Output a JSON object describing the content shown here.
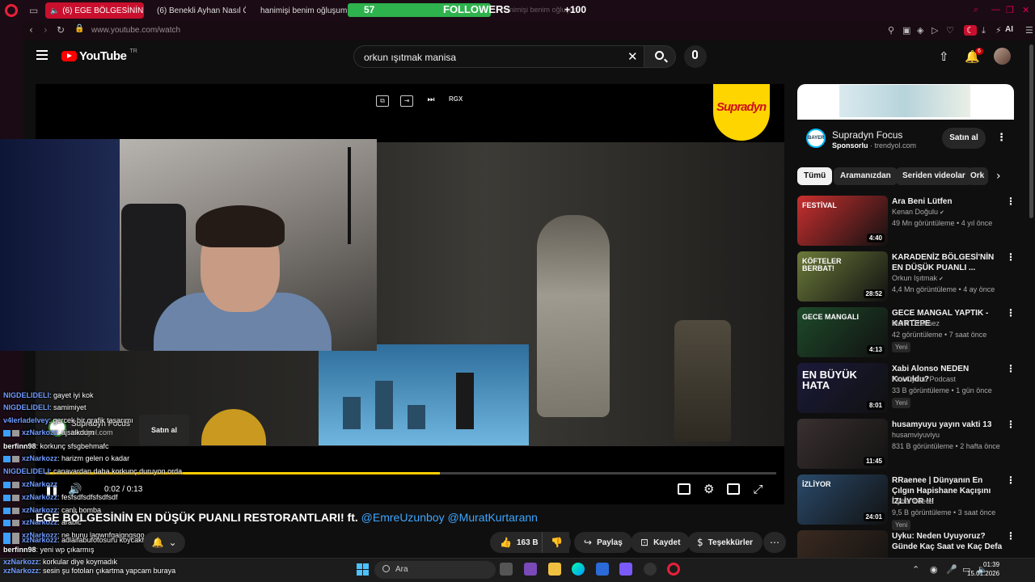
{
  "browser": {
    "tabs": [
      {
        "label": "(6) EGE BÖLGESİNİN E",
        "active": true
      },
      {
        "label": "(6) Benekli Ayhan Nasıl Öl",
        "active": false
      },
      {
        "label": "hanimişi benim oğluşum",
        "active": false
      }
    ],
    "faded_tab_text": "hanimişi benim oğluşum",
    "url": "www.youtube.com/watch",
    "ai_label": "AI"
  },
  "overlay_followers": {
    "current": "57",
    "label": "FOLLOWERS",
    "goal": "+100",
    "fill_fraction": 0.57,
    "color": "#2eb24d"
  },
  "youtube": {
    "logo_text": "YouTube",
    "region": "TR",
    "search_query": "orkun ışıtmak manisa",
    "notification_count": "6"
  },
  "player": {
    "overlay_btn": "RGX",
    "ad_brand": "Supradyn",
    "current_time": "0:02",
    "duration": "0:13",
    "time_display": "0:02 / 0:13",
    "progress_fraction": 0.54,
    "progress_color": "#ffcc00",
    "ad_overlay": {
      "name": "Supradyn Focus",
      "domain": "trendyol.com",
      "button": "Satın al"
    }
  },
  "video": {
    "title": "EGE BÖLGESİNİN EN DÜŞÜK PUANLI RESTORANTLARI! ft.",
    "mentions": "@EmreUzunboy @MuratKurtarann",
    "like_count": "163 B",
    "share_label": "Paylaş",
    "save_label": "Kaydet",
    "thanks_label": "Teşekkürler"
  },
  "chat": [
    {
      "user": "NIGDELIDELI",
      "message": ": gayet iyi kok"
    },
    {
      "user": "NIGDELIDELI",
      "message": ": samimiyet"
    },
    {
      "user": "v4lerladelvey",
      "message": ": gercek bir grafik tasarımı"
    },
    {
      "user": "xzNarkozz",
      "message": ": ajsalkdum"
    },
    {
      "user": "berfinn98",
      "message": ": korkunç sfsgbehmafc"
    },
    {
      "user": "xzNarkozz",
      "message": ": harizm gelen o kadar"
    },
    {
      "user": "NIGDELIDELI",
      "message": ": canavardan daha korkunç duruyon orda"
    },
    {
      "user": "xzNarkozz",
      "message": ""
    },
    {
      "user": "xzNarkozz",
      "message": ": fesfsdfsdfsfsdfsdf"
    },
    {
      "user": "xzNarkozz",
      "message": ": canlı bomba"
    },
    {
      "user": "xzNarkozz",
      "message": ": arabic"
    },
    {
      "user": "xzNarkozz",
      "message": ": ne bunu lagwnfgaigngsgo"
    },
    {
      "user": "xzNarkozz",
      "message": ": adlaifabufotosuru koycaktım"
    },
    {
      "user": "berfinn98",
      "message": ": yeni wp çıkarmış"
    },
    {
      "user": "xzNarkozz",
      "message": ": korkular diye koymadık"
    },
    {
      "user": "xzNarkozz",
      "message": ": sesin şu fotoları çıkartma yapcam buraya"
    }
  ],
  "sidebar": {
    "ad": {
      "name": "Supradyn Focus",
      "sponsored": "Sponsorlu",
      "domain": "trendyol.com",
      "button": "Satın al",
      "bayer": "BAYER"
    },
    "chips": [
      "Tümü",
      "Aramanızdan",
      "Seriden videolar",
      "Ork"
    ],
    "recommendations": [
      {
        "title": "Ara Beni Lütfen",
        "channel": "Kenan Doğulu",
        "verified": true,
        "meta": "49 Mn görüntüleme • 4 yıl önce",
        "duration": "4:40",
        "badge": "",
        "thumb_text": "FESTİVAL",
        "thumb_color": "#c92f2f"
      },
      {
        "title": "KARADENİZ BÖLGESİ'NİN EN DÜŞÜK PUANLI ...",
        "channel": "Orkun Işıtmak",
        "verified": true,
        "meta": "4,4 Mn görüntüleme • 4 ay önce",
        "duration": "28:52",
        "badge": "",
        "thumb_text": "KÖFTELER BERBAT!",
        "thumb_color": "#6b7a3a"
      },
      {
        "title": "GECE MANGAL YAPTIK - KARTEPE",
        "channel": "Melih Üzülmez",
        "verified": false,
        "meta": "42 görüntüleme • 7 saat önce",
        "duration": "4:13",
        "badge": "Yeni",
        "thumb_text": "GECE MANGALI",
        "thumb_color": "#1e4a2a"
      },
      {
        "title": "Xabi Alonso NEDEN Kovuldu?",
        "channel": "Akıl Oyunu Podcast",
        "verified": false,
        "meta": "33 B görüntüleme • 1 gün önce",
        "duration": "8:01",
        "badge": "Yeni",
        "thumb_text": "EN BÜYÜK HATA",
        "thumb_color": "#1a1a3a"
      },
      {
        "title": "husamyuyu yayın vakti 13",
        "channel": "husamviyuviyu",
        "verified": false,
        "meta": "831 B görüntüleme • 2 hafta önce",
        "duration": "11:45",
        "badge": "",
        "thumb_text": "",
        "thumb_color": "#3a3030"
      },
      {
        "title": "RRaenee | Dünyanın En Çılgın Hapishane Kaçışını İZLİYOR !!!",
        "channel": "CyberVideos",
        "verified": false,
        "meta": "9,5 B görüntüleme • 3 saat önce",
        "duration": "24:01",
        "badge": "Yeni",
        "thumb_text": "İZLİYOR",
        "thumb_color": "#2a4a6a"
      },
      {
        "title": "Uyku: Neden Uyuyoruz? Günde Kaç Saat ve Kaç Defa ...",
        "channel": "",
        "verified": false,
        "meta": "",
        "duration": "",
        "badge": "",
        "thumb_text": "",
        "thumb_color": "#3a2a20"
      }
    ]
  },
  "taskbar": {
    "search_placeholder": "Ara",
    "time": "01:39",
    "date": "15.01.2026"
  }
}
